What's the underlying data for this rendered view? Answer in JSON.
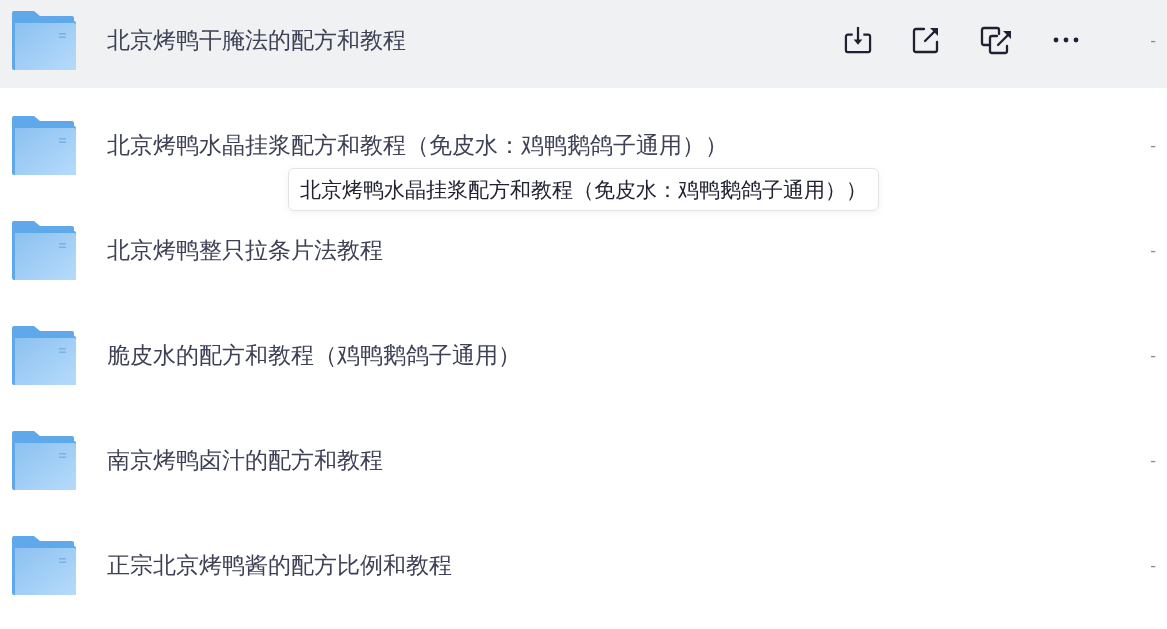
{
  "files": [
    {
      "name": "北京烤鸭干腌法的配方和教程",
      "size": "-",
      "hovered": true
    },
    {
      "name": "北京烤鸭水晶挂浆配方和教程（免皮水：鸡鸭鹅鸽子通用））",
      "size": "-",
      "hovered": false,
      "tooltip": "北京烤鸭水晶挂浆配方和教程（免皮水：鸡鸭鹅鸽子通用））"
    },
    {
      "name": "北京烤鸭整只拉条片法教程",
      "size": "-",
      "hovered": false
    },
    {
      "name": "脆皮水的配方和教程（鸡鸭鹅鸽子通用）",
      "size": "-",
      "hovered": false
    },
    {
      "name": "南京烤鸭卤汁的配方和教程",
      "size": "-",
      "hovered": false
    },
    {
      "name": "正宗北京烤鸭酱的配方比例和教程",
      "size": "-",
      "hovered": false
    }
  ]
}
